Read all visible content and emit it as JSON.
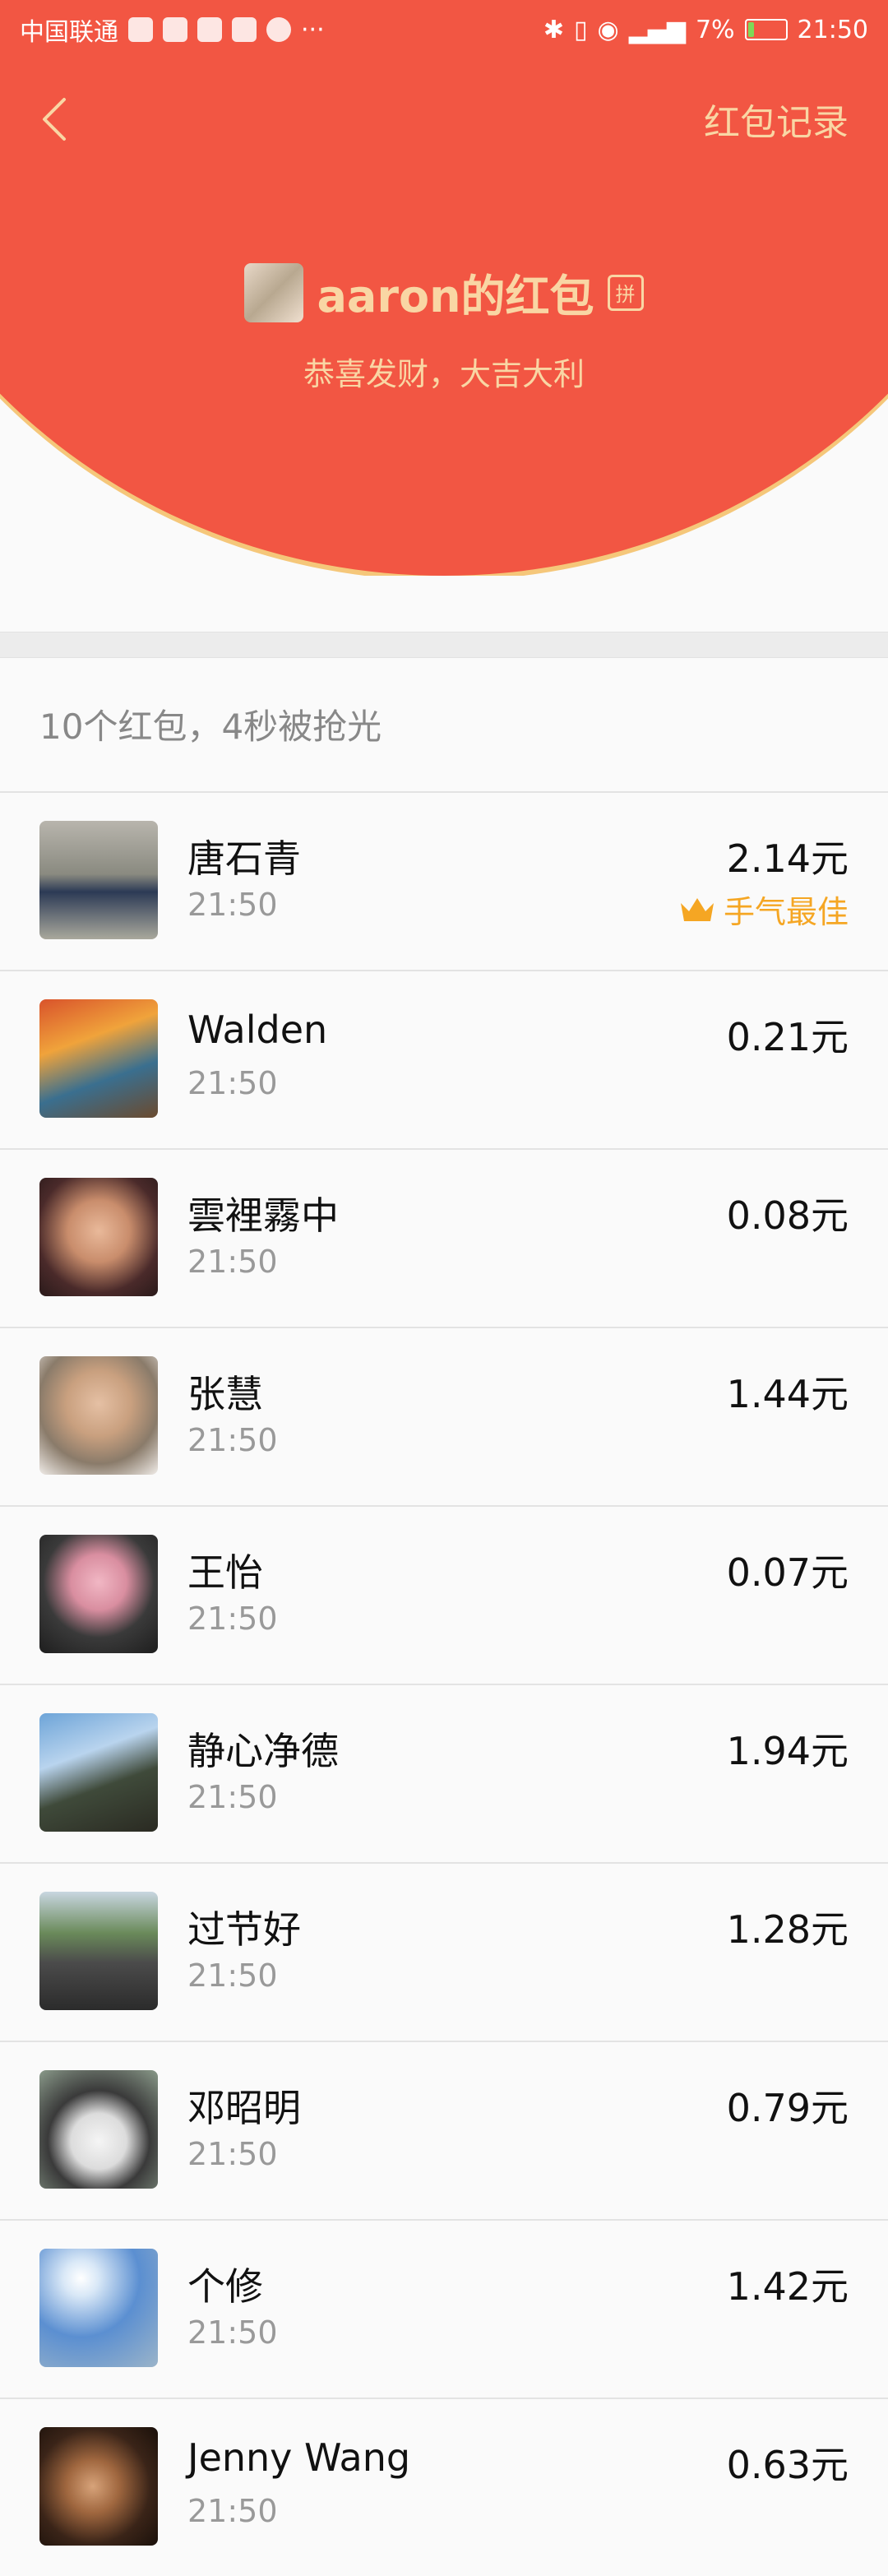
{
  "status_bar": {
    "carrier": "中国联通",
    "battery": "7%",
    "time": "21:50"
  },
  "header": {
    "records_link": "红包记录",
    "sender_name": "aaron的红包",
    "pin_badge": "拼",
    "blessing": "恭喜发财，大吉大利"
  },
  "summary": "10个红包，4秒被抢光",
  "best_luck_label": "手气最佳",
  "colors": {
    "header_red": "#f25643",
    "gold": "#f9d6a4",
    "best_luck": "#f5a623"
  },
  "items": [
    {
      "name": "唐石青",
      "time": "21:50",
      "amount": "2.14元"
    },
    {
      "name": "Walden",
      "time": "21:50",
      "amount": "0.21元"
    },
    {
      "name": "雲裡霧中",
      "time": "21:50",
      "amount": "0.08元"
    },
    {
      "name": "张慧",
      "time": "21:50",
      "amount": "1.44元"
    },
    {
      "name": "王怡",
      "time": "21:50",
      "amount": "0.07元"
    },
    {
      "name": "静心净德",
      "time": "21:50",
      "amount": "1.94元"
    },
    {
      "name": "过节好",
      "time": "21:50",
      "amount": "1.28元"
    },
    {
      "name": "邓昭明",
      "time": "21:50",
      "amount": "0.79元"
    },
    {
      "name": "个修",
      "time": "21:50",
      "amount": "1.42元"
    },
    {
      "name": "Jenny Wang",
      "time": "21:50",
      "amount": "0.63元"
    }
  ]
}
